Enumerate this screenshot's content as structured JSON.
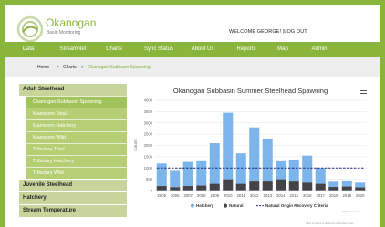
{
  "brand": {
    "name": "Okanogan",
    "subtitle": "Basin Monitoring"
  },
  "header": {
    "welcome": "WELCOME GEORGE!",
    "separator": "|",
    "logout": "LOG OUT"
  },
  "nav": [
    "Data",
    "StreamNet",
    "Charts",
    "Sync Status",
    "About Us",
    "Reports",
    "Map",
    "Admin"
  ],
  "breadcrumb": {
    "home": "Home",
    "sep1": ">",
    "charts": "Charts",
    "sep2": ">",
    "current": "Okanogan Subbasin Spawning"
  },
  "sidebar": {
    "sections": [
      {
        "title": "Adult Steelhead",
        "items": [
          "Okanogan Subbasin Spawning",
          "Mainstem Total",
          "Mainstem Hatchery",
          "Mainstem Wild",
          "Tributary Total",
          "Tributary Hatchery",
          "Tributary Wild"
        ],
        "active_index": 0
      },
      {
        "title": "Juvenile Steelhead",
        "items": []
      },
      {
        "title": "Hatchery",
        "items": []
      },
      {
        "title": "Stream Temperature",
        "items": []
      }
    ]
  },
  "colors": {
    "brand_green": "#8ab53c",
    "hatchery": "#7cb5ec",
    "natural": "#434348",
    "criteria": "#1f2a7a"
  },
  "credits": [
    "Highcharts.com",
    "Click on items in legend to hide/show them"
  ],
  "chart_data": {
    "type": "bar",
    "title": "Okanogan Subbasin Summer Steelhead Spawning",
    "ylabel": "Count",
    "xlabel": "",
    "ylim": [
      0,
      4000
    ],
    "yticks": [
      0,
      500,
      1000,
      1500,
      2000,
      2500,
      3000,
      3500,
      4000
    ],
    "stacked": true,
    "categories": [
      "2005",
      "2006",
      "2007",
      "2008",
      "2009",
      "2010",
      "2011",
      "2012",
      "2013",
      "2014",
      "2015",
      "2016",
      "2017",
      "2018",
      "2019",
      "2020"
    ],
    "series": [
      {
        "name": "Hatchery",
        "color": "#7cb5ec",
        "values": [
          1000,
          720,
          1070,
          1080,
          1800,
          2950,
          1350,
          2400,
          1900,
          800,
          950,
          1200,
          700,
          230,
          270,
          210
        ]
      },
      {
        "name": "Natural",
        "color": "#434348",
        "values": [
          200,
          150,
          200,
          220,
          300,
          500,
          300,
          400,
          400,
          500,
          400,
          350,
          300,
          160,
          180,
          140
        ]
      }
    ],
    "reference_line": {
      "name": "Natural Origin Recovery Criteria",
      "value": 1000,
      "style": "dashed"
    },
    "legend_position": "bottom",
    "grid": true
  }
}
